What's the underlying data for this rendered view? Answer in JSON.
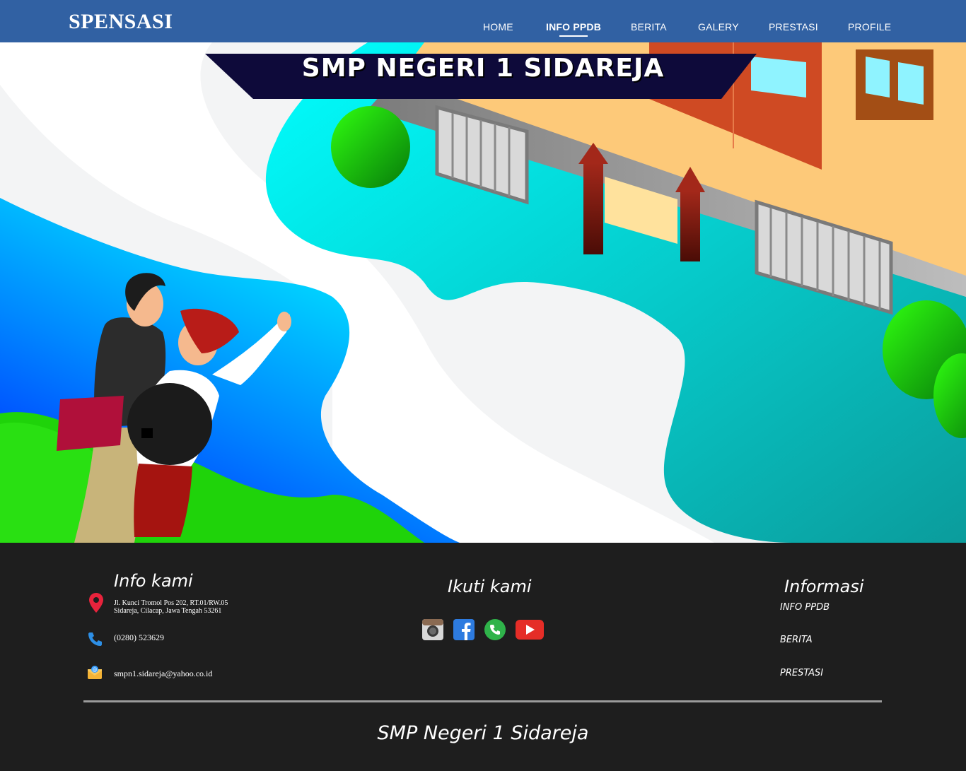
{
  "navbar": {
    "brand": "SPENSASI",
    "items": [
      {
        "label": "HOME"
      },
      {
        "label": "INFO PPDB"
      },
      {
        "label": "BERITA"
      },
      {
        "label": "GALERY"
      },
      {
        "label": "PRESTASI"
      },
      {
        "label": "PROFILE"
      }
    ],
    "active_item": "INFO PPDB"
  },
  "hero": {
    "banner_title": "SMP NEGERI 1 SIDAREJA"
  },
  "footer": {
    "info": {
      "heading": "Info kami",
      "address_line1": "Jl. Kunci Tromol Pos 202, RT.01/RW.05",
      "address_line2": "Sidareja, Cilacap, Jawa Tengah 53261",
      "phone": "(0280) 523629",
      "email": "smpn1.sidareja@yahoo.co.id"
    },
    "follow": {
      "heading": "Ikuti kami",
      "icons": [
        "instagram-icon",
        "facebook-icon",
        "whatsapp-icon",
        "youtube-icon"
      ]
    },
    "links": {
      "heading": "Informasi",
      "items": [
        {
          "label": "INFO PPDB"
        },
        {
          "label": "BERITA"
        },
        {
          "label": "PRESTASI"
        }
      ]
    },
    "bottom_title": "SMP Negeri 1 Sidareja"
  },
  "colors": {
    "navbar": "#3161a3",
    "footer": "#1e1e1e",
    "banner": "#0e0a3a",
    "pin": "#e8233c",
    "phone": "#2d8fe6"
  }
}
